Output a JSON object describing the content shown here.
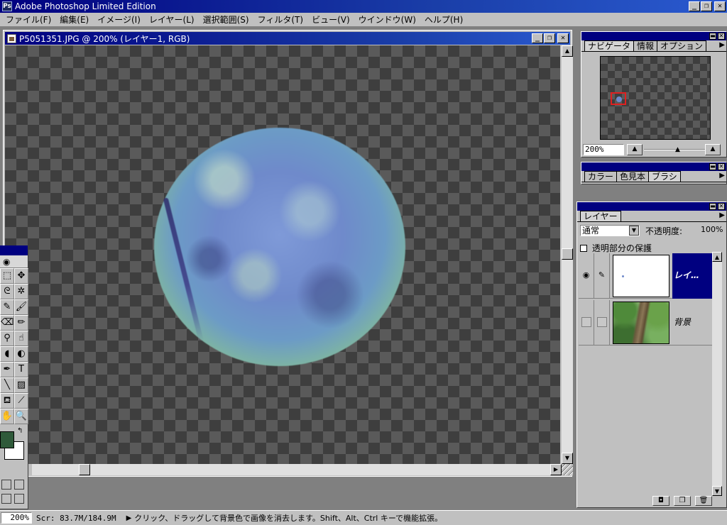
{
  "app": {
    "title": "Adobe Photoshop Limited Edition"
  },
  "window_controls": {
    "minimize": "_",
    "restore": "❐",
    "close": "✕"
  },
  "menu": [
    "ファイル(F)",
    "編集(E)",
    "イメージ(I)",
    "レイヤー(L)",
    "選択範囲(S)",
    "フィルタ(T)",
    "ビュー(V)",
    "ウインドウ(W)",
    "ヘルプ(H)"
  ],
  "document": {
    "title": "P5051351.JPG @ 200% (レイヤー1, RGB)"
  },
  "navigator": {
    "tabs": [
      "ナビゲータ",
      "情報",
      "オプション"
    ],
    "zoom": "200%"
  },
  "color_panel": {
    "tabs": [
      "カラー",
      "色見本",
      "ブラシ"
    ]
  },
  "layers_panel": {
    "tab": "レイヤー",
    "blend_mode": "通常",
    "opacity_label": "不透明度:",
    "opacity_value": "100%",
    "preserve_transparency": "透明部分の保護",
    "layers": [
      {
        "name": "レイ…",
        "selected": true,
        "visible": true
      },
      {
        "name": "背景",
        "selected": false,
        "visible": false
      }
    ]
  },
  "status": {
    "zoom": "200%",
    "scratch": "Scr: 83.7M/184.9M",
    "message": "クリック、ドラッグして背景色で画像を消去します。Shift、Alt、Ctrl キーで機能拡張。"
  },
  "colors": {
    "foreground": "#2f5a3a",
    "background": "#ffffff",
    "titlebar": "#000080"
  },
  "icons": [
    "eye-icon",
    "brush-icon",
    "hand-icon",
    "zoom-icon",
    "eraser-icon"
  ]
}
